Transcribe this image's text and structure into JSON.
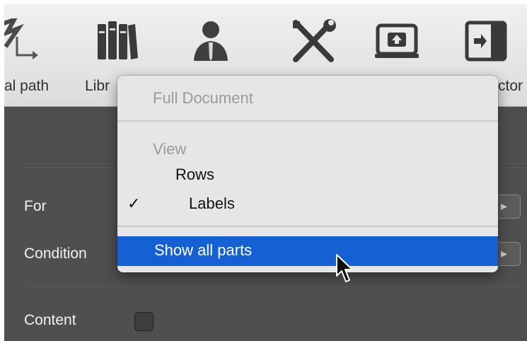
{
  "toolbar": {
    "items": [
      {
        "label": "al path",
        "icon": "xpath-arrow-icon"
      },
      {
        "label": "Libr",
        "icon": "library-books-icon"
      },
      {
        "label": "",
        "icon": "person-icon"
      },
      {
        "label": "",
        "icon": "tools-icon"
      },
      {
        "label": "",
        "icon": "upload-icon"
      },
      {
        "label": "ctor",
        "icon": "inspector-icon"
      }
    ]
  },
  "panel": {
    "for_label": "For",
    "condition_label": "Condition",
    "content_label": "Content"
  },
  "menu": {
    "full_document": "Full Document",
    "view_header": "View",
    "rows": "Rows",
    "labels": "Labels",
    "labels_check": "✓",
    "show_all": "Show all parts"
  },
  "colors": {
    "highlight": "#1560d3",
    "panel_bg": "#4f4f4f",
    "menu_bg": "#e6e6e6"
  }
}
